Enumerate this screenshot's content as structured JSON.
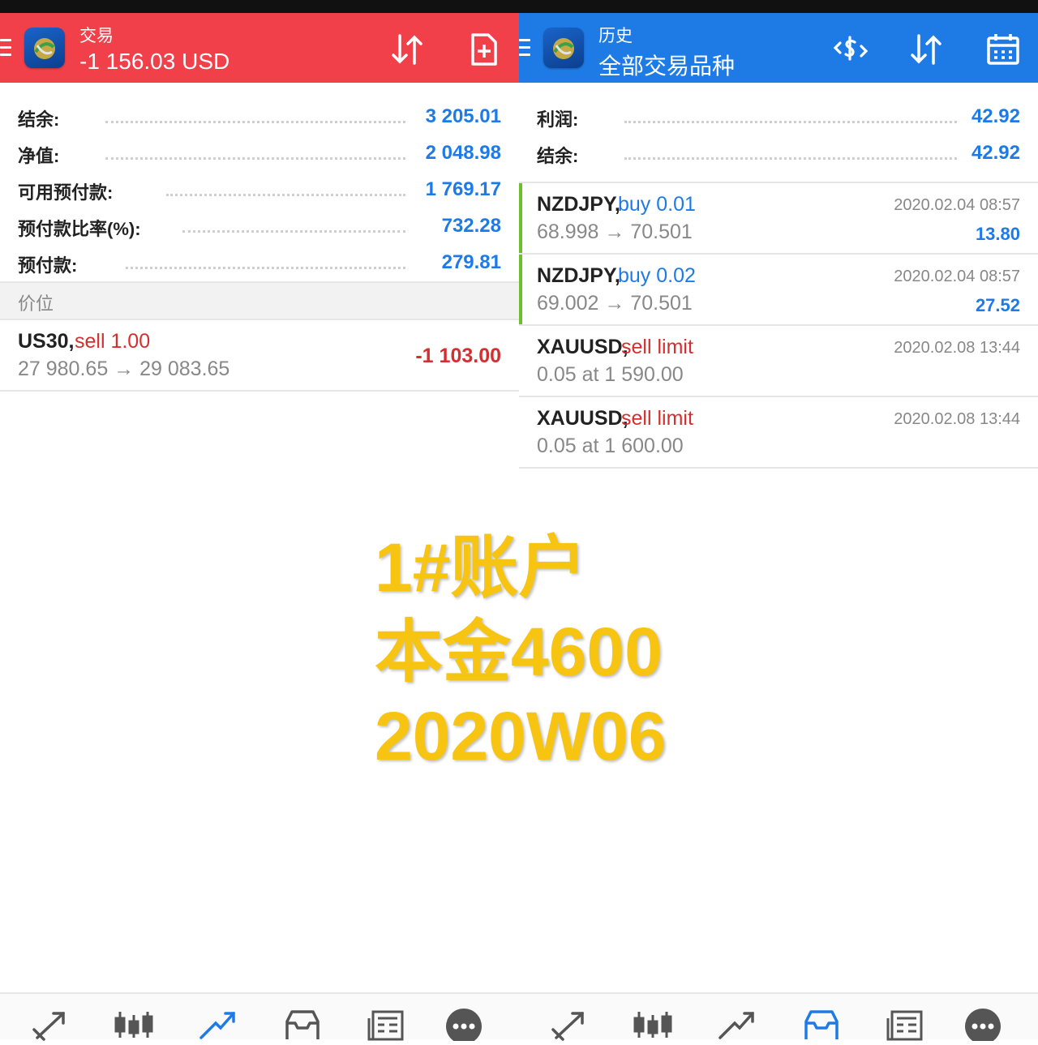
{
  "left_panel": {
    "header": {
      "title": "交易",
      "subtitle": "-1 156.03 USD"
    },
    "summary": [
      {
        "label": "结余:",
        "value": "3 205.01"
      },
      {
        "label": "净值:",
        "value": "2 048.98"
      },
      {
        "label": "可用预付款:",
        "value": "1 769.17"
      },
      {
        "label": "预付款比率(%):",
        "value": "732.28"
      },
      {
        "label": "预付款:",
        "value": "279.81"
      }
    ],
    "section_label": "价位",
    "position": {
      "symbol": "US30,",
      "side": "sell 1.00",
      "prices": "27 980.65 → 29 083.65",
      "profit": "-1 103.00"
    }
  },
  "right_panel": {
    "header": {
      "title": "历史",
      "subtitle": "全部交易品种"
    },
    "summary": [
      {
        "label": "利润:",
        "value": "42.92"
      },
      {
        "label": "结余:",
        "value": "42.92"
      }
    ],
    "deals": [
      {
        "symbol": "NZDJPY,",
        "side": "buy 0.01",
        "line2": "68.998 → 70.501",
        "time": "2020.02.04 08:57",
        "profit": "13.80"
      },
      {
        "symbol": "NZDJPY,",
        "side": "buy 0.02",
        "line2": "69.002 → 70.501",
        "time": "2020.02.04 08:57",
        "profit": "27.52"
      },
      {
        "symbol": "XAUUSD,",
        "side": "sell limit",
        "line2": "0.05 at 1 590.00",
        "time": "2020.02.08 13:44",
        "profit": ""
      },
      {
        "symbol": "XAUUSD,",
        "side": "sell limit",
        "line2": "0.05 at 1 600.00",
        "time": "2020.02.08 13:44",
        "profit": ""
      }
    ]
  },
  "overlay": {
    "line1": "1#账户",
    "line2": "本金4600",
    "line3": "2020W06"
  },
  "bottom_nav": {
    "left": [
      "quotes-icon",
      "chart-icon",
      "trade-icon",
      "history-icon",
      "news-icon",
      "chat-icon"
    ],
    "right": [
      "quotes-icon",
      "chart-icon",
      "trade-icon",
      "history-icon",
      "news-icon",
      "chat-icon"
    ],
    "left_active": "trade-icon",
    "right_active": "history-icon"
  },
  "colors": {
    "trade_header": "#f2404a",
    "history_header": "#1e7be6",
    "profit_blue": "#1e7be6",
    "loss_red": "#d32f2f",
    "overlay_yellow": "#f7c412"
  }
}
